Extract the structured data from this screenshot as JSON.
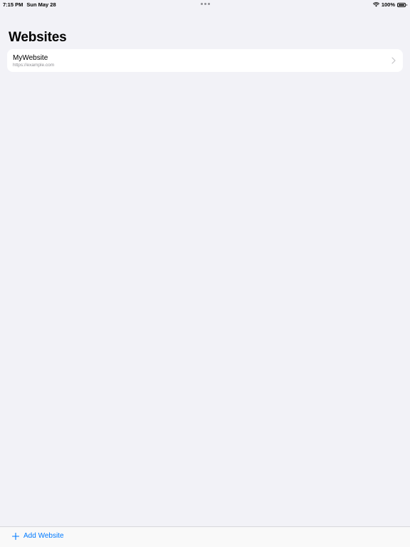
{
  "status_bar": {
    "time": "7:15 PM",
    "date": "Sun May 28",
    "battery": "100%",
    "icons": [
      "wifi-icon",
      "battery-icon",
      "multitasking-dots-icon"
    ]
  },
  "header": {
    "title": "Websites"
  },
  "websites": [
    {
      "name": "MyWebsite",
      "url": "https://example.com",
      "icon": "chevron-right-icon"
    }
  ],
  "toolbar": {
    "add_label": "Add Website",
    "add_icon": "plus-icon"
  },
  "colors": {
    "background": "#f2f2f7",
    "card": "#ffffff",
    "accent": "#007aff",
    "secondary_text": "#8e8e93"
  }
}
